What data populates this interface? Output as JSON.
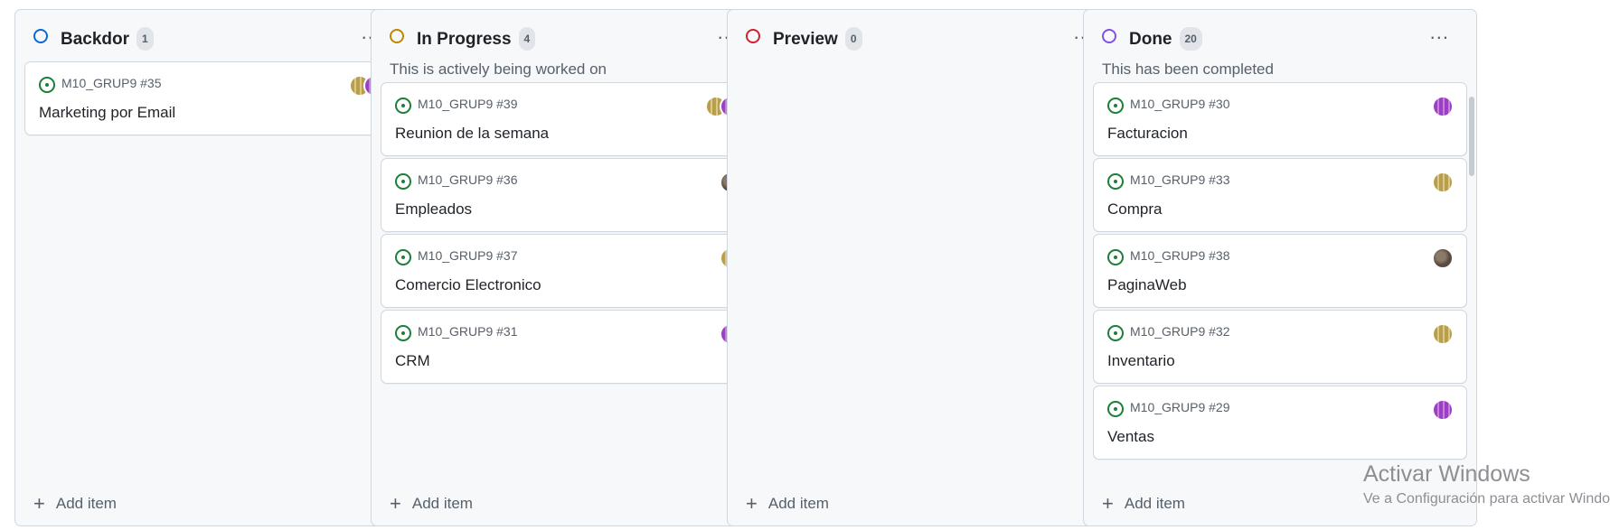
{
  "board": {
    "add_item_label": "Add item",
    "menu_label": "...",
    "columns": [
      {
        "title": "Backdor",
        "count": "1",
        "color": "#0969da",
        "description": "",
        "cards": [
          {
            "ref": "M10_GRUP9 #35",
            "title": "Marketing por Email",
            "avatars": [
              "avatar-yellow-pattern",
              "avatar-purple-pattern"
            ]
          }
        ]
      },
      {
        "title": "In Progress",
        "count": "4",
        "color": "#bf8700",
        "description": "This is actively being worked on",
        "cards": [
          {
            "ref": "M10_GRUP9 #39",
            "title": "Reunion de la semana",
            "avatars": [
              "avatar-yellow-pattern",
              "avatar-purple-pattern"
            ]
          },
          {
            "ref": "M10_GRUP9 #36",
            "title": "Empleados",
            "avatars": [
              "avatar-photo"
            ]
          },
          {
            "ref": "M10_GRUP9 #37",
            "title": "Comercio Electronico",
            "avatars": [
              "avatar-yellow-pattern"
            ]
          },
          {
            "ref": "M10_GRUP9 #31",
            "title": "CRM",
            "avatars": [
              "avatar-purple-pattern"
            ]
          }
        ]
      },
      {
        "title": "Preview",
        "count": "0",
        "color": "#cf222e",
        "description": "",
        "cards": []
      },
      {
        "title": "Done",
        "count": "20",
        "color": "#8250df",
        "description": "This has been completed",
        "cards": [
          {
            "ref": "M10_GRUP9 #30",
            "title": "Facturacion",
            "avatars": [
              "avatar-purple-pattern"
            ]
          },
          {
            "ref": "M10_GRUP9 #33",
            "title": "Compra",
            "avatars": [
              "avatar-yellow-pattern"
            ]
          },
          {
            "ref": "M10_GRUP9 #38",
            "title": "PaginaWeb",
            "avatars": [
              "avatar-photo"
            ]
          },
          {
            "ref": "M10_GRUP9 #32",
            "title": "Inventario",
            "avatars": [
              "avatar-yellow-pattern"
            ]
          },
          {
            "ref": "M10_GRUP9 #29",
            "title": "Ventas",
            "avatars": [
              "avatar-purple-pattern"
            ]
          }
        ]
      }
    ]
  },
  "watermark": {
    "title": "Activar Windows",
    "subtitle": "Ve a Configuración para activar Windows."
  },
  "avatar_colors": {
    "avatar-yellow-pattern": "#d9c98a",
    "avatar-purple-pattern": "#c77fe0",
    "avatar-photo": "#5b4a3f"
  }
}
